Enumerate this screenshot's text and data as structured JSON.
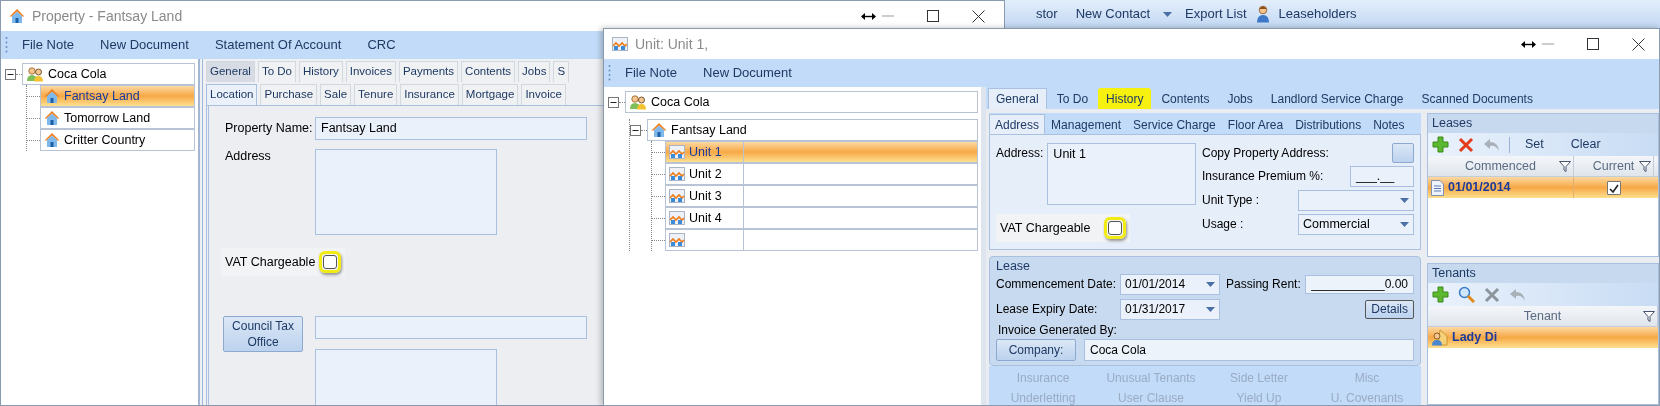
{
  "background_toolbar": [
    {
      "kind": "text",
      "label": "stor"
    },
    {
      "kind": "text",
      "label": "New Contact"
    },
    {
      "kind": "menu"
    },
    {
      "kind": "text",
      "label": "Export List"
    },
    {
      "kind": "person",
      "label": "Leaseholders"
    }
  ],
  "property_window": {
    "title": "Property - Fantsay Land",
    "toolbar": [
      "File Note",
      "New Document",
      "Statement Of Account",
      "CRC"
    ],
    "tree": {
      "kind": "contact",
      "label": "Coca Cola",
      "expanded": true,
      "selected": false,
      "children": [
        {
          "kind": "property",
          "label": "Fantsay Land",
          "selected": true
        },
        {
          "kind": "property",
          "label": "Tomorrow Land",
          "selected": false
        },
        {
          "kind": "property",
          "label": "Critter Country",
          "selected": false
        }
      ]
    },
    "tabs": [
      {
        "label": "General",
        "selected": true
      },
      {
        "label": "To Do",
        "selected": false
      },
      {
        "label": "History",
        "selected": false
      },
      {
        "label": "Invoices",
        "selected": false
      },
      {
        "label": "Payments",
        "selected": false
      },
      {
        "label": "Contents",
        "selected": false
      },
      {
        "label": "Jobs",
        "selected": false
      },
      {
        "label": "S",
        "selected": false
      }
    ],
    "subtabs": [
      {
        "label": "Location",
        "selected": true
      },
      {
        "label": "Purchase",
        "selected": false
      },
      {
        "label": "Sale",
        "selected": false
      },
      {
        "label": "Tenure",
        "selected": false
      },
      {
        "label": "Insurance",
        "selected": false
      },
      {
        "label": "Mortgage",
        "selected": false
      },
      {
        "label": "Invoice",
        "selected": false
      }
    ],
    "form": {
      "name_label": "Property Name:",
      "name_value": "Fantsay Land",
      "address_label": "Address",
      "vat_label": "VAT Chargeable",
      "vat_checked": false,
      "vat_highlighted": true,
      "council_button": "Council Tax Office"
    }
  },
  "unit_window": {
    "title": "Unit: Unit 1,",
    "toolbar": [
      "File Note",
      "New Document"
    ],
    "tree": {
      "kind": "contact",
      "label": "Coca Cola",
      "expanded": true,
      "selected": false,
      "children": [
        {
          "kind": "property",
          "label": "Fantsay Land",
          "expanded": true,
          "selected": false,
          "children": [
            {
              "kind": "unit",
              "label": "Unit 1",
              "selected": true
            },
            {
              "kind": "unit",
              "label": "Unit 2",
              "selected": false
            },
            {
              "kind": "unit",
              "label": "Unit 3",
              "selected": false
            },
            {
              "kind": "unit",
              "label": "Unit 4",
              "selected": false
            },
            {
              "kind": "unit",
              "selected": false
            }
          ]
        }
      ]
    },
    "tabs": [
      {
        "label": "General",
        "selected": true,
        "highlighted": false
      },
      {
        "label": "To Do",
        "selected": false,
        "highlighted": false
      },
      {
        "label": "History",
        "selected": false,
        "highlighted": true
      },
      {
        "label": "Contents",
        "selected": false,
        "highlighted": false
      },
      {
        "label": "Jobs",
        "selected": false,
        "highlighted": false
      },
      {
        "label": "Landlord Service Charge",
        "selected": false,
        "highlighted": false
      },
      {
        "label": "Scanned Documents",
        "selected": false,
        "highlighted": false
      }
    ],
    "subtabs": [
      {
        "label": "Address",
        "selected": true
      },
      {
        "label": "Management",
        "selected": false
      },
      {
        "label": "Service Charge",
        "selected": false
      },
      {
        "label": "Floor Area",
        "selected": false
      },
      {
        "label": "Distributions",
        "selected": false
      },
      {
        "label": "Notes",
        "selected": false
      }
    ],
    "address": {
      "label": "Address:",
      "value": "Unit 1",
      "copy_label": "Copy Property Address:",
      "premium_label": "Insurance Premium %:",
      "premium_value": "___.__",
      "unit_type_label": "Unit Type :",
      "usage_label": "Usage :",
      "usage_value": "Commercial",
      "vat_label": "VAT Chargeable",
      "vat_checked": false,
      "vat_highlighted": true
    },
    "lease": {
      "title": "Lease",
      "commencement_label": "Commencement Date:",
      "commencement_value": "01/01/2014",
      "rent_label": "Passing Rent:",
      "rent_value": "___________0.00",
      "expiry_label": "Lease Expiry Date:",
      "expiry_value": "01/31/2017",
      "details_button": "Details",
      "invoice_label": "Invoice Generated By:",
      "company_button": "Company:",
      "company_value": "Coca Cola"
    },
    "links": [
      {
        "label": "Insurance",
        "disabled": true
      },
      {
        "label": "Unusual Tenants",
        "disabled": true
      },
      {
        "label": "Side Letter",
        "disabled": true
      },
      {
        "label": "Misc",
        "disabled": true
      },
      {
        "label": "Underletting",
        "disabled": true
      },
      {
        "label": "User Clause",
        "disabled": true
      },
      {
        "label": "Yield Up",
        "disabled": true
      },
      {
        "label": "U. Covenants",
        "disabled": true
      }
    ],
    "leases": {
      "title": "Leases",
      "toolbar": [
        {
          "kind": "add",
          "disabled": false
        },
        {
          "kind": "delete",
          "disabled": false
        },
        {
          "kind": "undo",
          "disabled": true
        },
        {
          "kind": "separator"
        },
        {
          "kind": "text",
          "label": "Set",
          "disabled": false
        },
        {
          "kind": "text",
          "label": "Clear",
          "disabled": false
        }
      ],
      "columns": [
        "Commenced",
        "Current"
      ],
      "rows": [
        {
          "commenced": "01/01/2014",
          "current": true,
          "selected": true
        }
      ]
    },
    "tenants": {
      "title": "Tenants",
      "toolbar": [
        {
          "kind": "add",
          "disabled": false
        },
        {
          "kind": "search",
          "disabled": false
        },
        {
          "kind": "delete",
          "disabled": true
        },
        {
          "kind": "undo",
          "disabled": true
        }
      ],
      "columns": [
        "Tenant"
      ],
      "rows": [
        {
          "tenant": "Lady Di",
          "selected": true
        }
      ]
    }
  }
}
